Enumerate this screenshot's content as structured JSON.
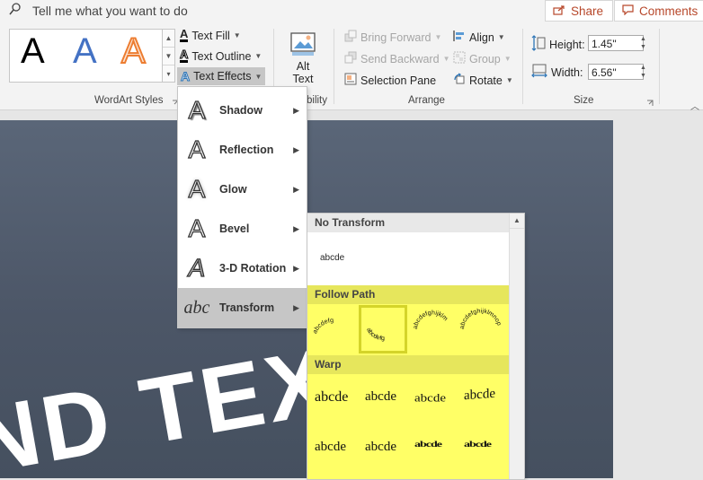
{
  "topbar": {
    "tell_me": "Tell me what you want to do",
    "share": "Share",
    "comments": "Comments"
  },
  "wordart": {
    "group_label": "WordArt Styles",
    "text_fill": "Text Fill",
    "text_outline": "Text Outline",
    "text_effects": "Text Effects",
    "sample_letter": "A"
  },
  "accessibility": {
    "alt_text_line1": "Alt",
    "alt_text_line2": "Text",
    "group_label_partial": "bility"
  },
  "arrange": {
    "group_label": "Arrange",
    "bring_forward": "Bring Forward",
    "send_backward": "Send Backward",
    "selection_pane": "Selection Pane",
    "align": "Align",
    "group": "Group",
    "rotate": "Rotate"
  },
  "size": {
    "group_label": "Size",
    "height_label": "Height:",
    "height_value": "1.45\"",
    "width_label": "Width:",
    "width_value": "6.56\""
  },
  "slide": {
    "visible_text": "ND TEXT"
  },
  "effects_menu": {
    "items": [
      {
        "label": "Shadow"
      },
      {
        "label": "Reflection"
      },
      {
        "label": "Glow"
      },
      {
        "label": "Bevel"
      },
      {
        "label": "3-D Rotation"
      },
      {
        "label": "Transform"
      }
    ]
  },
  "transform_panel": {
    "no_transform": "No Transform",
    "sample": "abcde",
    "follow_path": "Follow Path",
    "warp": "Warp",
    "path_samples": [
      "abcdefg",
      "abcdefg",
      "abcdefghijklm",
      "abcdefghijklmnop"
    ]
  },
  "colors": {
    "accent": "#b7472a",
    "highlight": "#ffff66",
    "slide": "#4f5a6b"
  }
}
